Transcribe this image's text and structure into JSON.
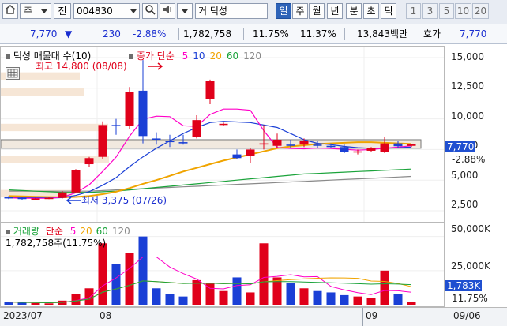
{
  "toolbar": {
    "market": "주",
    "prev": "전",
    "code": "004830",
    "name_prefix": "거",
    "stock_name": "덕성",
    "periods": [
      "일",
      "주",
      "월",
      "년",
      "분",
      "초",
      "틱"
    ],
    "intervals": [
      "1",
      "3",
      "5",
      "10",
      "20"
    ]
  },
  "quote": {
    "price": "7,770",
    "arrow": "▼",
    "change": "230",
    "change_pct": "-2.88%",
    "volume": "1,782,758",
    "turnover1": "11.75%",
    "turnover2": "11.37%",
    "amount": "13,843백만",
    "bid_label": "호가",
    "bid_price": "7,770"
  },
  "price_panel": {
    "title": "덕성 매물대 수(10)",
    "ma_label": "종가 단순",
    "ma_periods": [
      "5",
      "10",
      "20",
      "60",
      "120"
    ],
    "ma_colors": [
      "#ff00c8",
      "#1a3fd6",
      "#f0a400",
      "#1aa33a",
      "#8a8a8a"
    ],
    "high_label": "최고 14,800 (08/08)",
    "low_label": "최저 3,375 (07/26)",
    "y_ticks": [
      "15,000",
      "12,500",
      "10,000",
      "7,500",
      "5,000",
      "2,500"
    ],
    "current_tag": "7,770",
    "current_pct": "-2.88%"
  },
  "volume_panel": {
    "title": "거래량",
    "ma_label": "단순",
    "ma_periods": [
      "5",
      "20",
      "60",
      "120"
    ],
    "value_line": "1,782,758주(11.75%)",
    "y_ticks": [
      "50,000K",
      "25,000K"
    ],
    "current_tag": "1,783K",
    "current_pct": "11.75%"
  },
  "dates": {
    "d1": "2023/07",
    "d2": "08",
    "d3": "09",
    "d4": "09/06"
  },
  "chart_data": {
    "type": "candlestick",
    "ylim": [
      2500,
      15000
    ],
    "candles": [
      {
        "o": 3600,
        "h": 3700,
        "l": 3450,
        "c": 3550
      },
      {
        "o": 3550,
        "h": 3600,
        "l": 3375,
        "c": 3450
      },
      {
        "o": 3450,
        "h": 3550,
        "l": 3400,
        "c": 3500
      },
      {
        "o": 3500,
        "h": 3600,
        "l": 3450,
        "c": 3550
      },
      {
        "o": 3550,
        "h": 4100,
        "l": 3500,
        "c": 4000
      },
      {
        "o": 4000,
        "h": 5900,
        "l": 3950,
        "c": 5800
      },
      {
        "o": 6300,
        "h": 6900,
        "l": 6100,
        "c": 6800
      },
      {
        "o": 6900,
        "h": 9800,
        "l": 6700,
        "c": 9500
      },
      {
        "o": 9500,
        "h": 10000,
        "l": 8700,
        "c": 9400
      },
      {
        "o": 9400,
        "h": 12600,
        "l": 9200,
        "c": 12200
      },
      {
        "o": 12300,
        "h": 14800,
        "l": 8000,
        "c": 8600
      },
      {
        "o": 8400,
        "h": 8900,
        "l": 7900,
        "c": 8300
      },
      {
        "o": 8200,
        "h": 8700,
        "l": 7700,
        "c": 8100
      },
      {
        "o": 8100,
        "h": 8700,
        "l": 7900,
        "c": 8000
      },
      {
        "o": 8500,
        "h": 10300,
        "l": 8400,
        "c": 9900
      },
      {
        "o": 11600,
        "h": 13200,
        "l": 11200,
        "c": 13100
      },
      {
        "o": 9600,
        "h": 9700,
        "l": 9400,
        "c": 9600
      },
      {
        "o": 7100,
        "h": 7500,
        "l": 6700,
        "c": 6800
      },
      {
        "o": 7000,
        "h": 7600,
        "l": 6400,
        "c": 7500
      },
      {
        "o": 8000,
        "h": 9500,
        "l": 7500,
        "c": 8000
      },
      {
        "o": 7800,
        "h": 8800,
        "l": 7600,
        "c": 8300
      },
      {
        "o": 7900,
        "h": 8300,
        "l": 7600,
        "c": 7800
      },
      {
        "o": 7900,
        "h": 8400,
        "l": 7700,
        "c": 8200
      },
      {
        "o": 7900,
        "h": 8200,
        "l": 7600,
        "c": 7800
      },
      {
        "o": 7800,
        "h": 8000,
        "l": 7600,
        "c": 7700
      },
      {
        "o": 7700,
        "h": 7900,
        "l": 7200,
        "c": 7300
      },
      {
        "o": 7300,
        "h": 7500,
        "l": 7100,
        "c": 7350
      },
      {
        "o": 7400,
        "h": 7700,
        "l": 7300,
        "c": 7600
      },
      {
        "o": 7300,
        "h": 8500,
        "l": 7200,
        "c": 8000
      },
      {
        "o": 8000,
        "h": 8200,
        "l": 7600,
        "c": 7770
      },
      {
        "o": 7800,
        "h": 7950,
        "l": 7700,
        "c": 7950
      }
    ],
    "ma5": [
      3550,
      3520,
      3520,
      3510,
      3610,
      3960,
      4620,
      5710,
      6880,
      8580,
      9960,
      10220,
      10180,
      9440,
      9380,
      10360,
      10800,
      10800,
      10700,
      9040,
      7660,
      7580,
      7560,
      7620,
      7580,
      7520,
      7450,
      7500,
      7600,
      7700,
      7800
    ],
    "ma10": [
      3600,
      3580,
      3560,
      3540,
      3570,
      3750,
      4060,
      4580,
      5200,
      6100,
      6900,
      7600,
      8200,
      8800,
      9300,
      9700,
      9800,
      9750,
      9700,
      9500,
      9300,
      8800,
      8300,
      8000,
      7900,
      7750,
      7650,
      7600,
      7600,
      7650,
      7700
    ],
    "ma20": [
      3700,
      3680,
      3650,
      3620,
      3600,
      3630,
      3700,
      3850,
      4050,
      4350,
      4700,
      5000,
      5350,
      5700,
      6000,
      6300,
      6600,
      6850,
      7100,
      7350,
      7600,
      7750,
      7850,
      7950,
      8000,
      8050,
      8100,
      8100,
      8050,
      8000,
      7950
    ],
    "ma60": [
      4200,
      4150,
      4100,
      4050,
      4000,
      4000,
      4000,
      4050,
      4100,
      4200,
      4300,
      4400,
      4500,
      4600,
      4700,
      4800,
      4900,
      5000,
      5100,
      5200,
      5300,
      5400,
      5500,
      5550,
      5600,
      5650,
      5700,
      5750,
      5800,
      5850,
      5900
    ],
    "ma120": [
      4100,
      4100,
      4100,
      4100,
      4100,
      4100,
      4100,
      4150,
      4200,
      4250,
      4300,
      4350,
      4400,
      4450,
      4500,
      4550,
      4600,
      4650,
      4700,
      4750,
      4800,
      4850,
      4900,
      4950,
      5000,
      5050,
      5100,
      5150,
      5200,
      5250,
      5300
    ],
    "volume_k": [
      2000,
      1500,
      1200,
      1000,
      3000,
      8000,
      12000,
      45000,
      30000,
      38000,
      50000,
      12000,
      8000,
      6000,
      18000,
      16000,
      10000,
      20000,
      9000,
      45000,
      20000,
      16000,
      12000,
      10000,
      9000,
      7000,
      6000,
      5000,
      25000,
      8000,
      1783
    ],
    "volume_ylim": [
      0,
      55000
    ],
    "overlay_zones": [
      {
        "from": 13200,
        "to": 13800
      },
      {
        "from": 11900,
        "to": 12500
      },
      {
        "from": 9000,
        "to": 9600
      },
      {
        "from": 7700,
        "to": 8300
      },
      {
        "from": 6400,
        "to": 7000
      },
      {
        "from": 3600,
        "to": 4200
      }
    ]
  }
}
